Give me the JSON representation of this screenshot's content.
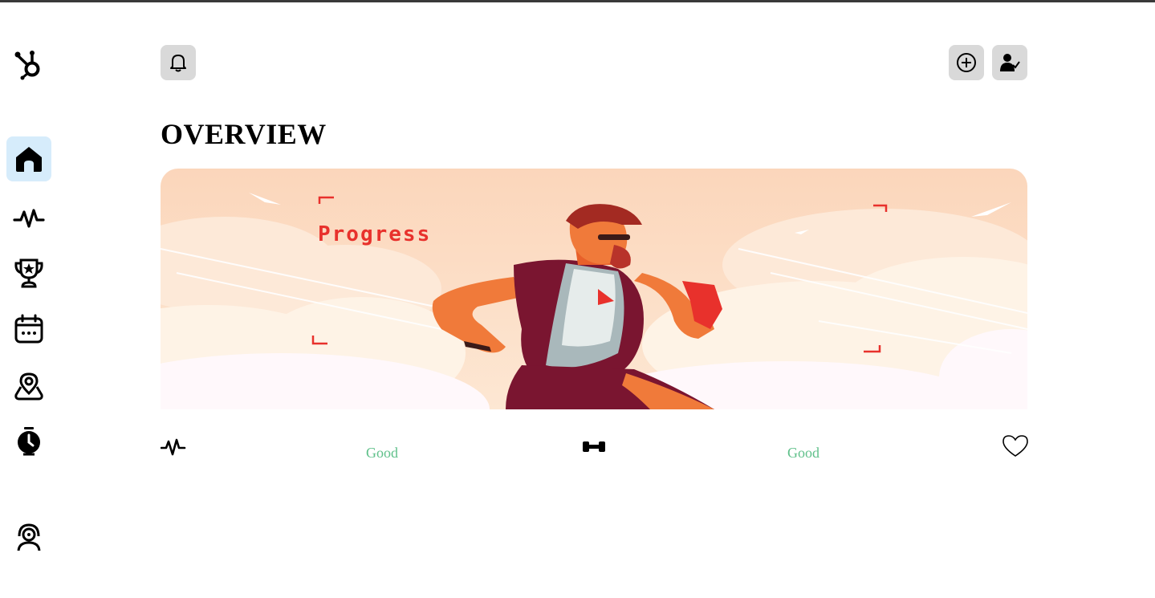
{
  "page": {
    "title": "OVERVIEW"
  },
  "banner": {
    "text": "Progress"
  },
  "sidebar": {
    "logo": "hubspot-logo-icon",
    "items": [
      {
        "icon": "home-icon",
        "active": true
      },
      {
        "icon": "activity-pulse-icon"
      },
      {
        "icon": "trophy-icon"
      },
      {
        "icon": "calendar-icon"
      },
      {
        "icon": "map-location-icon"
      },
      {
        "icon": "stopwatch-icon"
      },
      {
        "icon": "support-agent-icon"
      }
    ]
  },
  "header": {
    "notifications_icon": "bell-icon",
    "add_icon": "plus-circle-icon",
    "profile_icon": "user-check-icon"
  },
  "stats": [
    {
      "icon": "activity-pulse-icon",
      "status": "Good"
    },
    {
      "icon": "dumbbell-icon",
      "status": "Good"
    },
    {
      "icon": "heart-icon"
    }
  ],
  "colors": {
    "active_nav_bg": "#d6ecfb",
    "button_bg": "#d9d9d9",
    "status_good": "#5fc08a",
    "banner_peach": "#fbd8bd",
    "accent_red": "#e8312c"
  }
}
